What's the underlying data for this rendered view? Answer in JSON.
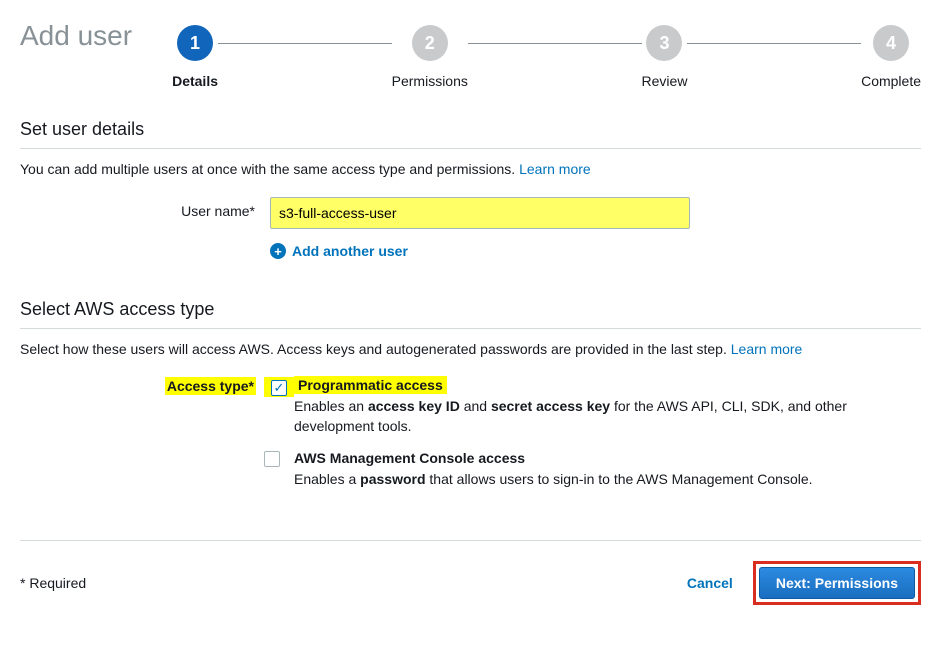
{
  "page_title": "Add user",
  "steps": [
    {
      "num": "1",
      "label": "Details",
      "active": true
    },
    {
      "num": "2",
      "label": "Permissions",
      "active": false
    },
    {
      "num": "3",
      "label": "Review",
      "active": false
    },
    {
      "num": "4",
      "label": "Complete",
      "active": false
    }
  ],
  "user_details": {
    "section_title": "Set user details",
    "desc": "You can add multiple users at once with the same access type and permissions.",
    "learn_more": "Learn more",
    "user_name_label": "User name*",
    "user_name_value": "s3-full-access-user",
    "add_another": "Add another user"
  },
  "access_type": {
    "section_title": "Select AWS access type",
    "desc": "Select how these users will access AWS. Access keys and autogenerated passwords are provided in the last step.",
    "learn_more": "Learn more",
    "label": "Access type*",
    "options": [
      {
        "title": "Programmatic access",
        "checked": true,
        "highlighted": true,
        "desc_pre": "Enables an ",
        "desc_b1": "access key ID",
        "desc_mid": " and ",
        "desc_b2": "secret access key",
        "desc_post": " for the AWS API, CLI, SDK, and other development tools."
      },
      {
        "title": "AWS Management Console access",
        "checked": false,
        "highlighted": false,
        "desc_pre": "Enables a ",
        "desc_b1": "password",
        "desc_mid": "",
        "desc_b2": "",
        "desc_post": " that allows users to sign-in to the AWS Management Console."
      }
    ]
  },
  "footer": {
    "required": "* Required",
    "cancel": "Cancel",
    "next": "Next: Permissions"
  }
}
